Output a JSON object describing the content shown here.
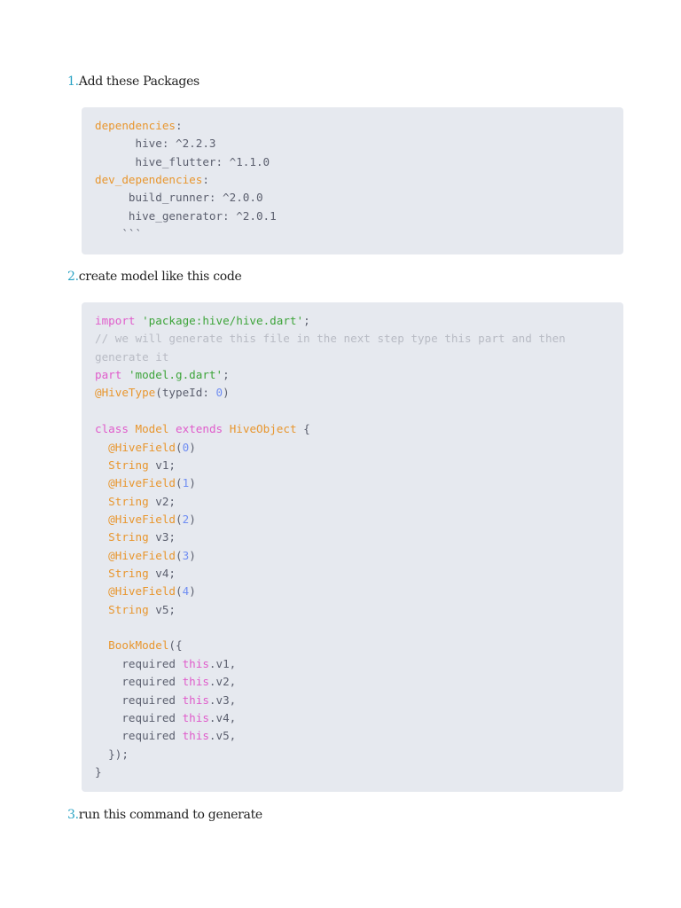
{
  "steps": [
    {
      "number": "1.",
      "text": "Add these Packages"
    },
    {
      "number": "2.",
      "text": "create model like this code"
    },
    {
      "number": "3.",
      "text": "run this command to generate"
    }
  ],
  "code_blocks": [
    {
      "lines": [
        [
          [
            "an",
            "dependencies"
          ],
          [
            "pl",
            ":"
          ]
        ],
        [
          [
            "pl",
            "      hive: ^2.2.3"
          ]
        ],
        [
          [
            "pl",
            "      hive_flutter: ^1.1.0"
          ]
        ],
        [
          [
            "an",
            "dev_dependencies"
          ],
          [
            "pl",
            ":"
          ]
        ],
        [
          [
            "pl",
            "     build_runner: ^2.0.0"
          ]
        ],
        [
          [
            "pl",
            "     hive_generator: ^2.0.1"
          ]
        ],
        [
          [
            "pl",
            "    ```"
          ]
        ]
      ]
    },
    {
      "lines": [
        [
          [
            "kw",
            "import"
          ],
          [
            "pl",
            " "
          ],
          [
            "str",
            "'package:hive/hive.dart'"
          ],
          [
            "pl",
            ";"
          ]
        ],
        [
          [
            "cm",
            "// we will generate this file in the next step type this part and then"
          ]
        ],
        [
          [
            "cm",
            "generate it"
          ]
        ],
        [
          [
            "kw",
            "part"
          ],
          [
            "pl",
            " "
          ],
          [
            "str",
            "'model.g.dart'"
          ],
          [
            "pl",
            ";"
          ]
        ],
        [
          [
            "an",
            "@HiveType"
          ],
          [
            "pl",
            "(typeId: "
          ],
          [
            "num",
            "0"
          ],
          [
            "pl",
            ")"
          ]
        ],
        [],
        [
          [
            "kw",
            "class"
          ],
          [
            "pl",
            " "
          ],
          [
            "an",
            "Model"
          ],
          [
            "pl",
            " "
          ],
          [
            "kw",
            "extends"
          ],
          [
            "pl",
            " "
          ],
          [
            "an",
            "HiveObject"
          ],
          [
            "pl",
            " {"
          ]
        ],
        [
          [
            "pl",
            "  "
          ],
          [
            "an",
            "@HiveField"
          ],
          [
            "pl",
            "("
          ],
          [
            "num",
            "0"
          ],
          [
            "pl",
            ")"
          ]
        ],
        [
          [
            "pl",
            "  "
          ],
          [
            "an",
            "String"
          ],
          [
            "pl",
            " v1;"
          ]
        ],
        [
          [
            "pl",
            "  "
          ],
          [
            "an",
            "@HiveField"
          ],
          [
            "pl",
            "("
          ],
          [
            "num",
            "1"
          ],
          [
            "pl",
            ")"
          ]
        ],
        [
          [
            "pl",
            "  "
          ],
          [
            "an",
            "String"
          ],
          [
            "pl",
            " v2;"
          ]
        ],
        [
          [
            "pl",
            "  "
          ],
          [
            "an",
            "@HiveField"
          ],
          [
            "pl",
            "("
          ],
          [
            "num",
            "2"
          ],
          [
            "pl",
            ")"
          ]
        ],
        [
          [
            "pl",
            "  "
          ],
          [
            "an",
            "String"
          ],
          [
            "pl",
            " v3;"
          ]
        ],
        [
          [
            "pl",
            "  "
          ],
          [
            "an",
            "@HiveField"
          ],
          [
            "pl",
            "("
          ],
          [
            "num",
            "3"
          ],
          [
            "pl",
            ")"
          ]
        ],
        [
          [
            "pl",
            "  "
          ],
          [
            "an",
            "String"
          ],
          [
            "pl",
            " v4;"
          ]
        ],
        [
          [
            "pl",
            "  "
          ],
          [
            "an",
            "@HiveField"
          ],
          [
            "pl",
            "("
          ],
          [
            "num",
            "4"
          ],
          [
            "pl",
            ")"
          ]
        ],
        [
          [
            "pl",
            "  "
          ],
          [
            "an",
            "String"
          ],
          [
            "pl",
            " v5;"
          ]
        ],
        [],
        [
          [
            "pl",
            "  "
          ],
          [
            "an",
            "BookModel"
          ],
          [
            "pl",
            "({"
          ]
        ],
        [
          [
            "pl",
            "    required "
          ],
          [
            "kw",
            "this"
          ],
          [
            "pl",
            ".v1,"
          ]
        ],
        [
          [
            "pl",
            "    required "
          ],
          [
            "kw",
            "this"
          ],
          [
            "pl",
            ".v2,"
          ]
        ],
        [
          [
            "pl",
            "    required "
          ],
          [
            "kw",
            "this"
          ],
          [
            "pl",
            ".v3,"
          ]
        ],
        [
          [
            "pl",
            "    required "
          ],
          [
            "kw",
            "this"
          ],
          [
            "pl",
            ".v4,"
          ]
        ],
        [
          [
            "pl",
            "    required "
          ],
          [
            "kw",
            "this"
          ],
          [
            "pl",
            ".v5,"
          ]
        ],
        [
          [
            "pl",
            "  });"
          ]
        ],
        [
          [
            "pl",
            "}"
          ]
        ]
      ]
    }
  ]
}
